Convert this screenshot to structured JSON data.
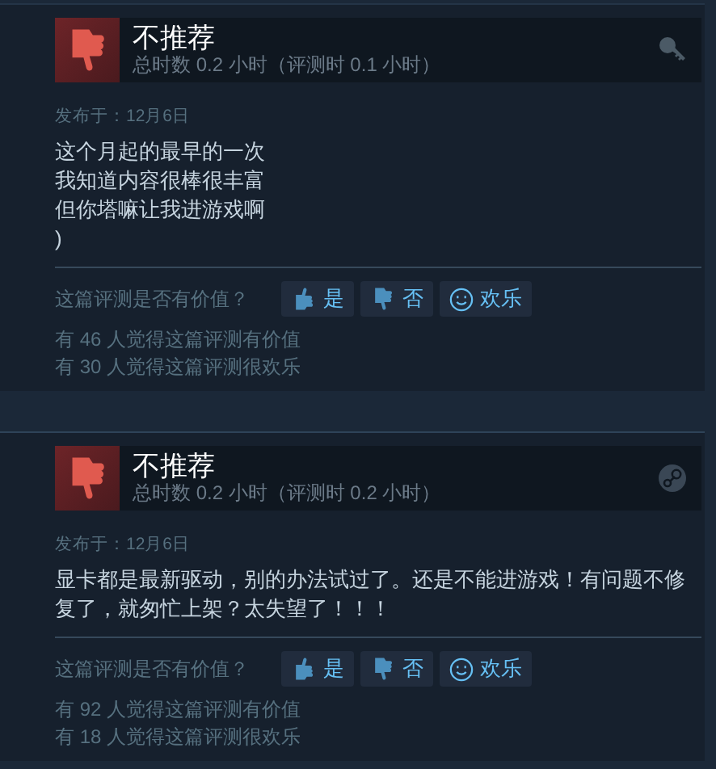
{
  "reviews": [
    {
      "recommended": false,
      "verdict": "不推荐",
      "hours": "总时数 0.2 小时（评测时 0.1 小时）",
      "source_icon": {
        "kind": "key"
      },
      "posted": "发布于：12月6日",
      "body": [
        "这个月起的最早的一次",
        "我知道内容很棒很丰富",
        "但你塔嘛让我进游戏啊",
        ")"
      ],
      "helpful_prompt": "这篇评测是否有价值？",
      "buttons": [
        {
          "kind": "yes",
          "label": "是"
        },
        {
          "kind": "no",
          "label": "否"
        },
        {
          "kind": "funny",
          "label": "欢乐"
        }
      ],
      "counts": [
        "有 46 人觉得这篇评测有价值",
        "有 30 人觉得这篇评测很欢乐"
      ]
    },
    {
      "recommended": false,
      "verdict": "不推荐",
      "hours": "总时数 0.2 小时（评测时 0.2 小时）",
      "source_icon": {
        "kind": "steam"
      },
      "posted": "发布于：12月6日",
      "body": [
        "显卡都是最新驱动，别的办法试过了。还是不能进游戏！有问题不修复了，就匆忙上架？太失望了！！！"
      ],
      "helpful_prompt": "这篇评测是否有价值？",
      "buttons": [
        {
          "kind": "yes",
          "label": "是"
        },
        {
          "kind": "no",
          "label": "否"
        },
        {
          "kind": "funny",
          "label": "欢乐"
        }
      ],
      "counts": [
        "有 92 人觉得这篇评测有价值",
        "有 18 人觉得这篇评测很欢乐"
      ]
    }
  ]
}
